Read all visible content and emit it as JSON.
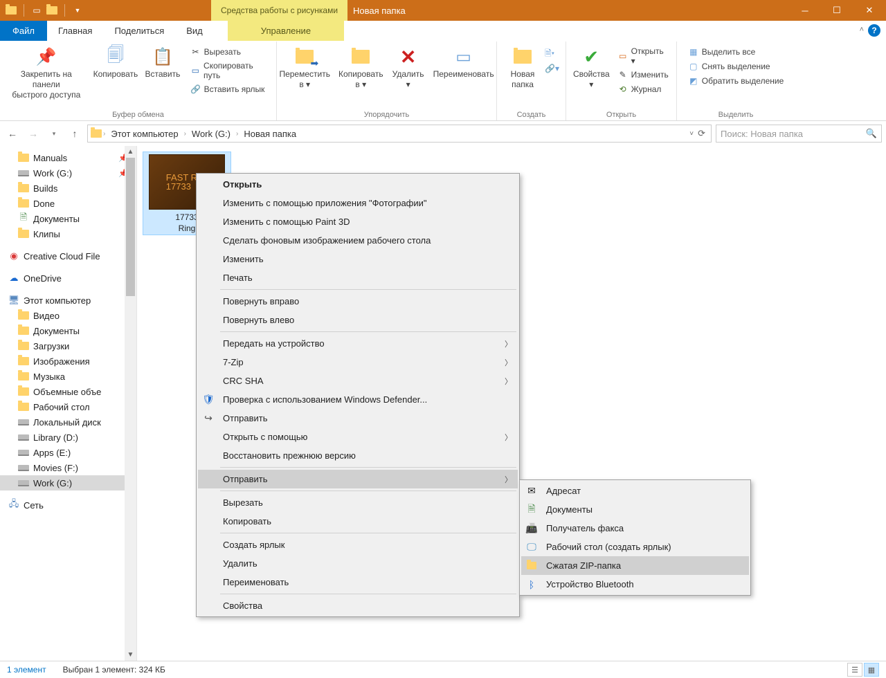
{
  "titlebar": {
    "tool_tab": "Средства работы с рисунками",
    "window_title": "Новая папка"
  },
  "tabs": {
    "file": "Файл",
    "home": "Главная",
    "share": "Поделиться",
    "view": "Вид",
    "manage": "Управление"
  },
  "ribbon": {
    "g_clipboard": {
      "label": "Буфер обмена",
      "pin": "Закрепить на панели\nбыстрого доступа",
      "copy": "Копировать",
      "paste": "Вставить",
      "cut": "Вырезать",
      "copy_path": "Скопировать путь",
      "paste_shortcut": "Вставить ярлык"
    },
    "g_organize": {
      "label": "Упорядочить",
      "moveto": "Переместить\nв ▾",
      "copyto": "Копировать\nв ▾",
      "delete": "Удалить\n▾",
      "rename": "Переименовать"
    },
    "g_new": {
      "label": "Создать",
      "newfolder": "Новая\nпапка"
    },
    "g_open": {
      "label": "Открыть",
      "props": "Свойства\n▾",
      "open": "Открыть ▾",
      "edit": "Изменить",
      "history": "Журнал"
    },
    "g_select": {
      "label": "Выделить",
      "select_all": "Выделить все",
      "select_none": "Снять выделение",
      "invert": "Обратить выделение"
    }
  },
  "breadcrumb": {
    "this_pc": "Этот компьютер",
    "drive": "Work (G:)",
    "folder": "Новая папка"
  },
  "search": {
    "placeholder": "Поиск: Новая папка"
  },
  "tree": {
    "quick": [
      {
        "label": "Manuals",
        "icon": "folder",
        "pin": true
      },
      {
        "label": "Work (G:)",
        "icon": "drive",
        "pin": true
      },
      {
        "label": "Builds",
        "icon": "folder"
      },
      {
        "label": "Done",
        "icon": "folder"
      },
      {
        "label": "Документы",
        "icon": "doc"
      },
      {
        "label": "Клипы",
        "icon": "folder"
      }
    ],
    "cloud1": "Creative Cloud File",
    "onedrive": "OneDrive",
    "this_pc": "Этот компьютер",
    "pc_children": [
      {
        "label": "Видео"
      },
      {
        "label": "Документы"
      },
      {
        "label": "Загрузки"
      },
      {
        "label": "Изображения"
      },
      {
        "label": "Музыка"
      },
      {
        "label": "Объемные объе"
      },
      {
        "label": "Рабочий стол"
      },
      {
        "label": "Локальный диск"
      },
      {
        "label": "Library (D:)"
      },
      {
        "label": "Apps (E:)"
      },
      {
        "label": "Movies (F:)"
      },
      {
        "label": "Work (G:)",
        "sel": true
      }
    ],
    "network": "Сеть"
  },
  "file_item": {
    "thumb_text": "FAST RING\n17733",
    "name": "17733\nRing"
  },
  "context_menu": [
    {
      "label": "Открыть",
      "bold": true
    },
    {
      "label": "Изменить с помощью приложения \"Фотографии\""
    },
    {
      "label": "Изменить с помощью Paint 3D"
    },
    {
      "label": "Сделать фоновым изображением рабочего стола"
    },
    {
      "label": "Изменить"
    },
    {
      "label": "Печать"
    },
    {
      "sep": true
    },
    {
      "label": "Повернуть вправо"
    },
    {
      "label": "Повернуть влево"
    },
    {
      "sep": true
    },
    {
      "label": "Передать на устройство",
      "arrow": true
    },
    {
      "label": "7-Zip",
      "arrow": true
    },
    {
      "label": "CRC SHA",
      "arrow": true
    },
    {
      "label": "Проверка с использованием Windows Defender...",
      "icon": "shield"
    },
    {
      "label": "Отправить",
      "icon": "share"
    },
    {
      "label": "Открыть с помощью",
      "arrow": true
    },
    {
      "label": "Восстановить прежнюю версию"
    },
    {
      "sep": true
    },
    {
      "label": "Отправить",
      "arrow": true,
      "hi": true
    },
    {
      "sep": true
    },
    {
      "label": "Вырезать"
    },
    {
      "label": "Копировать"
    },
    {
      "sep": true
    },
    {
      "label": "Создать ярлык"
    },
    {
      "label": "Удалить"
    },
    {
      "label": "Переименовать"
    },
    {
      "sep": true
    },
    {
      "label": "Свойства"
    }
  ],
  "submenu": [
    {
      "label": "Адресат",
      "icon": "mail"
    },
    {
      "label": "Документы",
      "icon": "doc"
    },
    {
      "label": "Получатель факса",
      "icon": "fax"
    },
    {
      "label": "Рабочий стол (создать ярлык)",
      "icon": "desktop"
    },
    {
      "label": "Сжатая ZIP-папка",
      "icon": "zip",
      "hi": true
    },
    {
      "label": "Устройство Bluetooth",
      "icon": "bt"
    }
  ],
  "statusbar": {
    "items": "1 элемент",
    "selection": "Выбран 1 элемент: 324 КБ"
  }
}
